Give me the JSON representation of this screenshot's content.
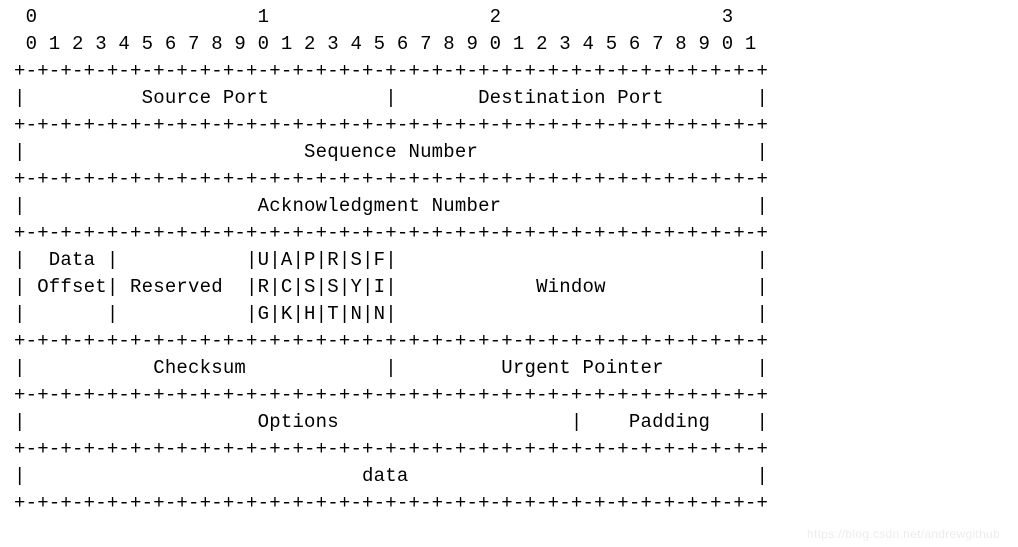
{
  "ruler": {
    "tens_line": " 0                   1                   2                   3  ",
    "units_line": " 0 1 2 3 4 5 6 7 8 9 0 1 2 3 4 5 6 7 8 9 0 1 2 3 4 5 6 7 8 9 0 1"
  },
  "sep_full": "+-+-+-+-+-+-+-+-+-+-+-+-+-+-+-+-+-+-+-+-+-+-+-+-+-+-+-+-+-+-+-+-+",
  "fields": {
    "source_port": "Source Port",
    "destination_port": "Destination Port",
    "sequence_number": "Sequence Number",
    "ack_number": "Acknowledgment Number",
    "data_offset_l1": "Data",
    "data_offset_l2": "Offset",
    "reserved": "Reserved",
    "window": "Window",
    "flags_row1": [
      "U",
      "A",
      "P",
      "R",
      "S",
      "F"
    ],
    "flags_row2": [
      "R",
      "C",
      "S",
      "S",
      "Y",
      "I"
    ],
    "flags_row3": [
      "G",
      "K",
      "H",
      "T",
      "N",
      "N"
    ],
    "checksum": "Checksum",
    "urgent_pointer": "Urgent Pointer",
    "options": "Options",
    "padding": "Padding",
    "data": "data"
  },
  "lines": {
    "row_ports": "|          Source Port          |       Destination Port        |",
    "row_seq": "|                        Sequence Number                        |",
    "row_ack": "|                    Acknowledgment Number                      |",
    "row_flags1": "|  Data |           |U|A|P|R|S|F|                               |",
    "row_flags2": "| Offset| Reserved  |R|C|S|S|Y|I|            Window             |",
    "row_flags3": "|       |           |G|K|H|T|N|N|                               |",
    "row_checksum": "|           Checksum            |         Urgent Pointer        |",
    "row_options": "|                    Options                    |    Padding    |",
    "row_data": "|                             data                              |"
  },
  "watermark": "https://blog.csdn.net/andrewgithub"
}
